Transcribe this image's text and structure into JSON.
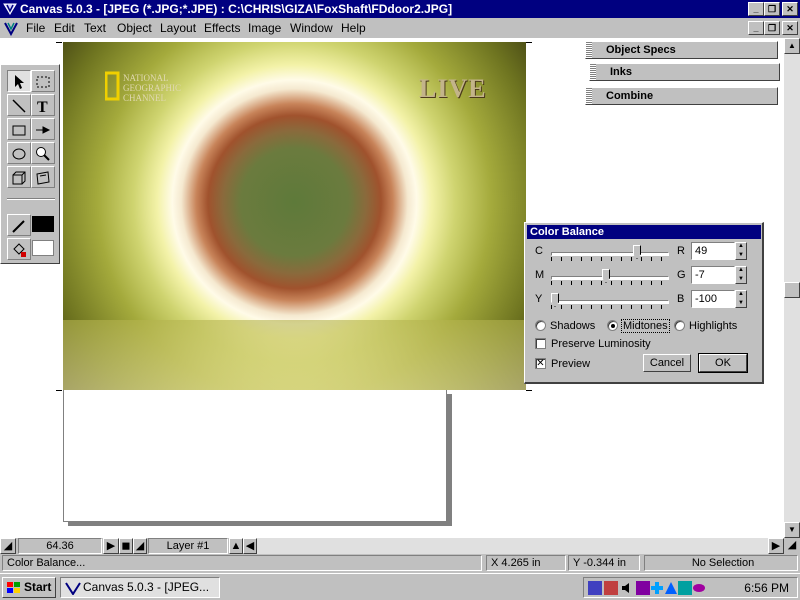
{
  "window": {
    "title": "Canvas 5.0.3 - [JPEG (*.JPG;*.JPE) : C:\\CHRIS\\GIZA\\FoxShaft\\FDdoor2.JPG]",
    "controls": {
      "minimize": "_",
      "restore": "❐",
      "close": "✕"
    }
  },
  "menubar": {
    "items": [
      {
        "label": "File"
      },
      {
        "label": "Edit"
      },
      {
        "label": "Text"
      },
      {
        "label": "Object"
      },
      {
        "label": "Layout"
      },
      {
        "label": "Effects"
      },
      {
        "label": "Image"
      },
      {
        "label": "Window"
      },
      {
        "label": "Help"
      }
    ]
  },
  "image": {
    "logo_lines": [
      "NATIONAL",
      "GEOGRAPHIC",
      "CHANNEL"
    ],
    "live_badge": "LIVE"
  },
  "palettes": {
    "object_specs": "Object Specs",
    "inks": "Inks",
    "combine": "Combine"
  },
  "color_balance": {
    "title": "Color Balance",
    "sliders": [
      {
        "left": "C",
        "right": "R",
        "value": "49",
        "position": 0.745
      },
      {
        "left": "M",
        "right": "G",
        "value": "-7",
        "position": 0.465
      },
      {
        "left": "Y",
        "right": "B",
        "value": "-100",
        "position": 0.0
      }
    ],
    "tones": {
      "shadows": "Shadows",
      "midtones": "Midtones",
      "highlights": "Highlights",
      "selected": "Midtones"
    },
    "preserve_luminosity": {
      "label": "Preserve Luminosity",
      "checked": false
    },
    "preview": {
      "label": "Preview",
      "checked": true
    },
    "cancel": "Cancel",
    "ok": "OK"
  },
  "bottom_bar": {
    "zoom": "64.36",
    "layer": "Layer #1"
  },
  "statusbar": {
    "message": "Color Balance...",
    "x": "X 4.265 in",
    "y": "Y -0.344 in",
    "selection": "No Selection"
  },
  "taskbar": {
    "start": "Start",
    "task": "Canvas 5.0.3 - [JPEG...",
    "clock": "6:56 PM"
  }
}
